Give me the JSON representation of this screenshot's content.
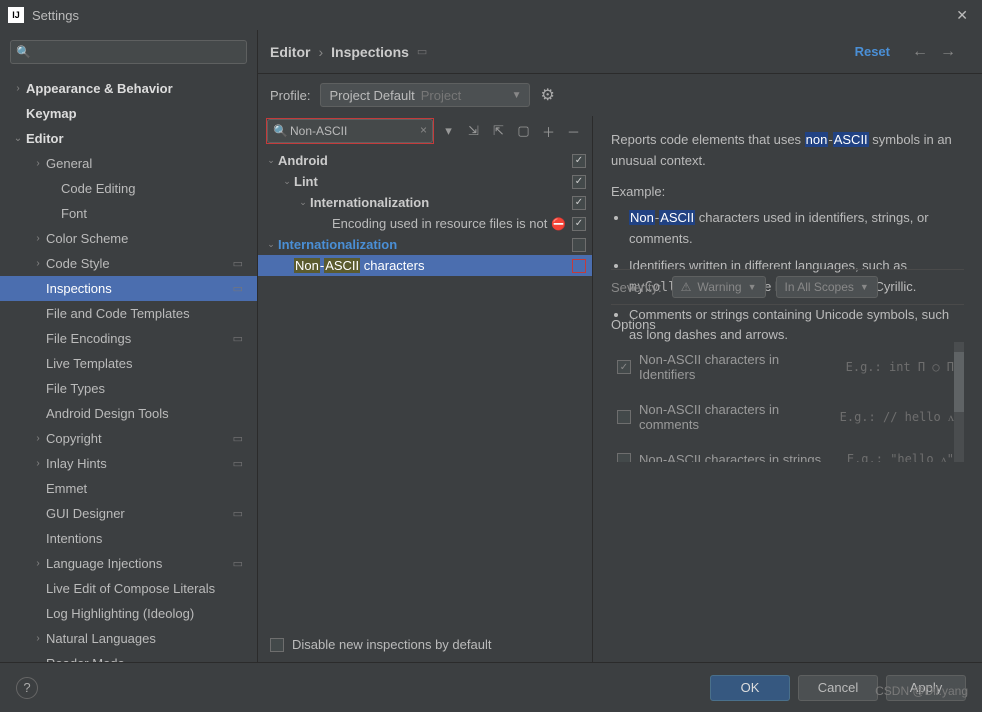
{
  "window": {
    "title": "Settings"
  },
  "header": {
    "breadcrumb": [
      "Editor",
      "Inspections"
    ],
    "reset": "Reset"
  },
  "sidebar": {
    "search_placeholder": "",
    "items": [
      {
        "label": "Appearance & Behavior",
        "level": 1,
        "arrow": "›",
        "bold": true
      },
      {
        "label": "Keymap",
        "level": 1,
        "arrow": "",
        "bold": true
      },
      {
        "label": "Editor",
        "level": 1,
        "arrow": "⌄",
        "bold": true
      },
      {
        "label": "General",
        "level": 2,
        "arrow": "›"
      },
      {
        "label": "Code Editing",
        "level": 3,
        "arrow": ""
      },
      {
        "label": "Font",
        "level": 3,
        "arrow": ""
      },
      {
        "label": "Color Scheme",
        "level": 2,
        "arrow": "›"
      },
      {
        "label": "Code Style",
        "level": 2,
        "arrow": "›",
        "end": "▭"
      },
      {
        "label": "Inspections",
        "level": 2,
        "arrow": "",
        "selected": true,
        "end": "▭"
      },
      {
        "label": "File and Code Templates",
        "level": 2,
        "arrow": ""
      },
      {
        "label": "File Encodings",
        "level": 2,
        "arrow": "",
        "end": "▭"
      },
      {
        "label": "Live Templates",
        "level": 2,
        "arrow": ""
      },
      {
        "label": "File Types",
        "level": 2,
        "arrow": ""
      },
      {
        "label": "Android Design Tools",
        "level": 2,
        "arrow": ""
      },
      {
        "label": "Copyright",
        "level": 2,
        "arrow": "›",
        "end": "▭"
      },
      {
        "label": "Inlay Hints",
        "level": 2,
        "arrow": "›",
        "end": "▭"
      },
      {
        "label": "Emmet",
        "level": 2,
        "arrow": ""
      },
      {
        "label": "GUI Designer",
        "level": 2,
        "arrow": "",
        "end": "▭"
      },
      {
        "label": "Intentions",
        "level": 2,
        "arrow": ""
      },
      {
        "label": "Language Injections",
        "level": 2,
        "arrow": "›",
        "end": "▭"
      },
      {
        "label": "Live Edit of Compose Literals",
        "level": 2,
        "arrow": ""
      },
      {
        "label": "Log Highlighting (Ideolog)",
        "level": 2,
        "arrow": ""
      },
      {
        "label": "Natural Languages",
        "level": 2,
        "arrow": "›"
      },
      {
        "label": "Reader Mode",
        "level": 2,
        "arrow": "",
        "end": "▭"
      }
    ]
  },
  "profile": {
    "label": "Profile:",
    "value": "Project Default",
    "scope": "Project"
  },
  "inspections": {
    "search_value": "Non-ASCII",
    "tree": [
      {
        "label": "Android",
        "level": 1,
        "arrow": "⌄",
        "bold": true,
        "checked": true
      },
      {
        "label": "Lint",
        "level": 2,
        "arrow": "⌄",
        "bold": true,
        "checked": true
      },
      {
        "label": "Internationalization",
        "level": 3,
        "arrow": "⌄",
        "bold": true,
        "checked": true
      },
      {
        "label": "Encoding used in resource files is not",
        "level": 4,
        "arrow": "",
        "checked": true,
        "error": true
      },
      {
        "label": "Internationalization",
        "level": 1,
        "arrow": "⌄",
        "bold": true,
        "link": true,
        "checked": false
      },
      {
        "label_html": "<span class='hl'>Non</span>-<span class='hl'>ASCII</span> characters",
        "level": 2,
        "arrow": "",
        "selected": true,
        "checked": false
      }
    ],
    "disable_label": "Disable new inspections by default"
  },
  "detail": {
    "intro_html": "Reports code elements that uses <span class='hlb'>non</span>-<span class='hlb'>ASCII</span> symbols in an unusual context.",
    "example_label": "Example:",
    "bullets": [
      "<span class='hlb'>Non</span>-<span class='hlb'>ASCII</span> characters used in identifiers, strings, or comments.",
      "Identifiers written in different languages, such as <code>myCollection</code> with the letter <code>C</code> written in Cyrillic.",
      "Comments or strings containing Unicode symbols, such as long dashes and arrows."
    ],
    "severity_label": "Severity:",
    "severity_value": "Warning",
    "scope_value": "In All Scopes",
    "options_label": "Options",
    "options": [
      {
        "label": "Non-ASCII characters in Identifiers",
        "checked": true,
        "eg": "E.g.: int Π ○ Π"
      },
      {
        "label": "Non-ASCII characters in comments",
        "checked": false,
        "eg": "E.g.: // hello ᴧ"
      },
      {
        "label": "Non-ASCII characters in strings",
        "checked": false,
        "eg": "E.g.: \"hello ᴧ\""
      }
    ]
  },
  "footer": {
    "ok": "OK",
    "cancel": "Cancel",
    "apply": "Apply"
  },
  "watermark": "CSDN @Dil.yang"
}
